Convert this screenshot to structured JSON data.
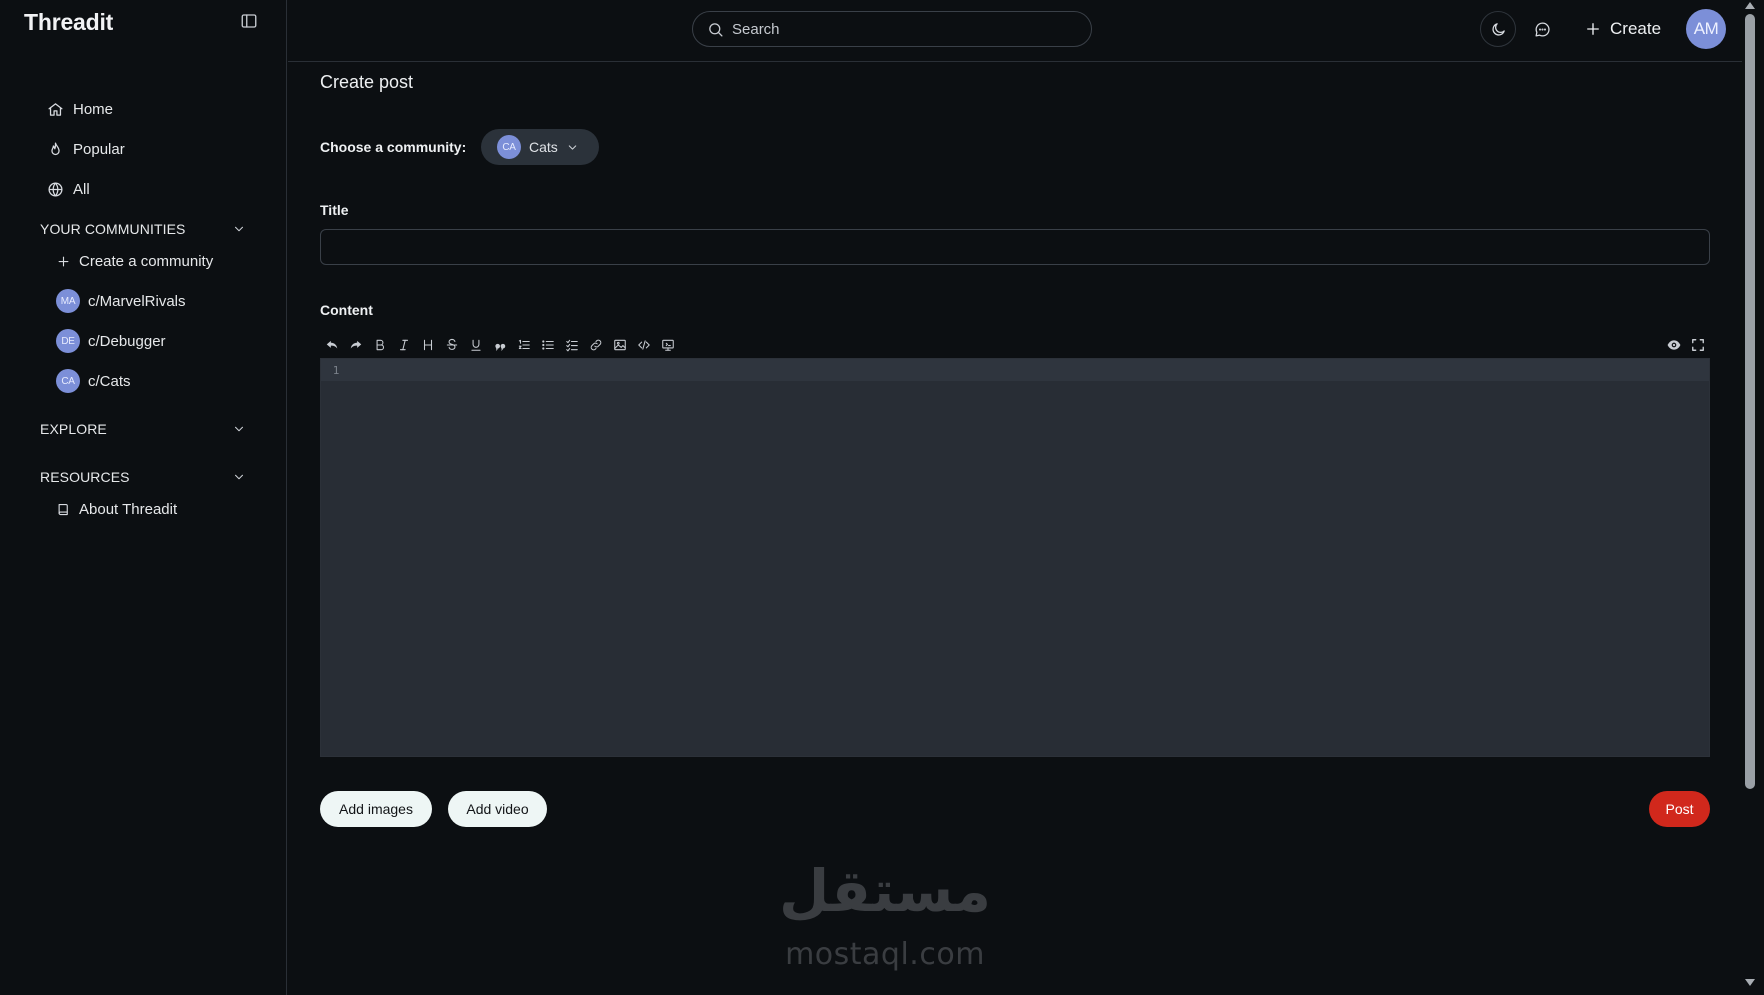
{
  "brand": "Threadit",
  "sidebar": {
    "nav": [
      {
        "label": "Home",
        "icon": "home-icon"
      },
      {
        "label": "Popular",
        "icon": "flame-icon"
      },
      {
        "label": "All",
        "icon": "globe-icon"
      }
    ],
    "your_communities": {
      "title": "YOUR COMMUNITIES",
      "create_label": "Create a community",
      "items": [
        {
          "avatar": "MA",
          "label": "c/MarvelRivals"
        },
        {
          "avatar": "DE",
          "label": "c/Debugger"
        },
        {
          "avatar": "CA",
          "label": "c/Cats"
        }
      ]
    },
    "explore": {
      "title": "EXPLORE"
    },
    "resources": {
      "title": "RESOURCES",
      "items": [
        {
          "label": "About Threadit",
          "icon": "book-icon"
        }
      ]
    }
  },
  "header": {
    "search_placeholder": "Search",
    "create_label": "Create",
    "user_initials": "AM"
  },
  "main": {
    "page_title": "Create post",
    "community_label": "Choose a community:",
    "community_selected": {
      "avatar": "CA",
      "label": "Cats"
    },
    "title_label": "Title",
    "title_value": "",
    "content_label": "Content",
    "editor_first_line_number": "1",
    "add_images_label": "Add images",
    "add_video_label": "Add video",
    "post_label": "Post"
  },
  "watermark": {
    "arabic": "مستقل",
    "latin": "mostaql.com"
  },
  "colors": {
    "background": "#0c0f12",
    "avatar": "#7c8fd8",
    "post_button": "#d1281c",
    "light_button": "#eef6f5",
    "editor": "#282d35"
  }
}
